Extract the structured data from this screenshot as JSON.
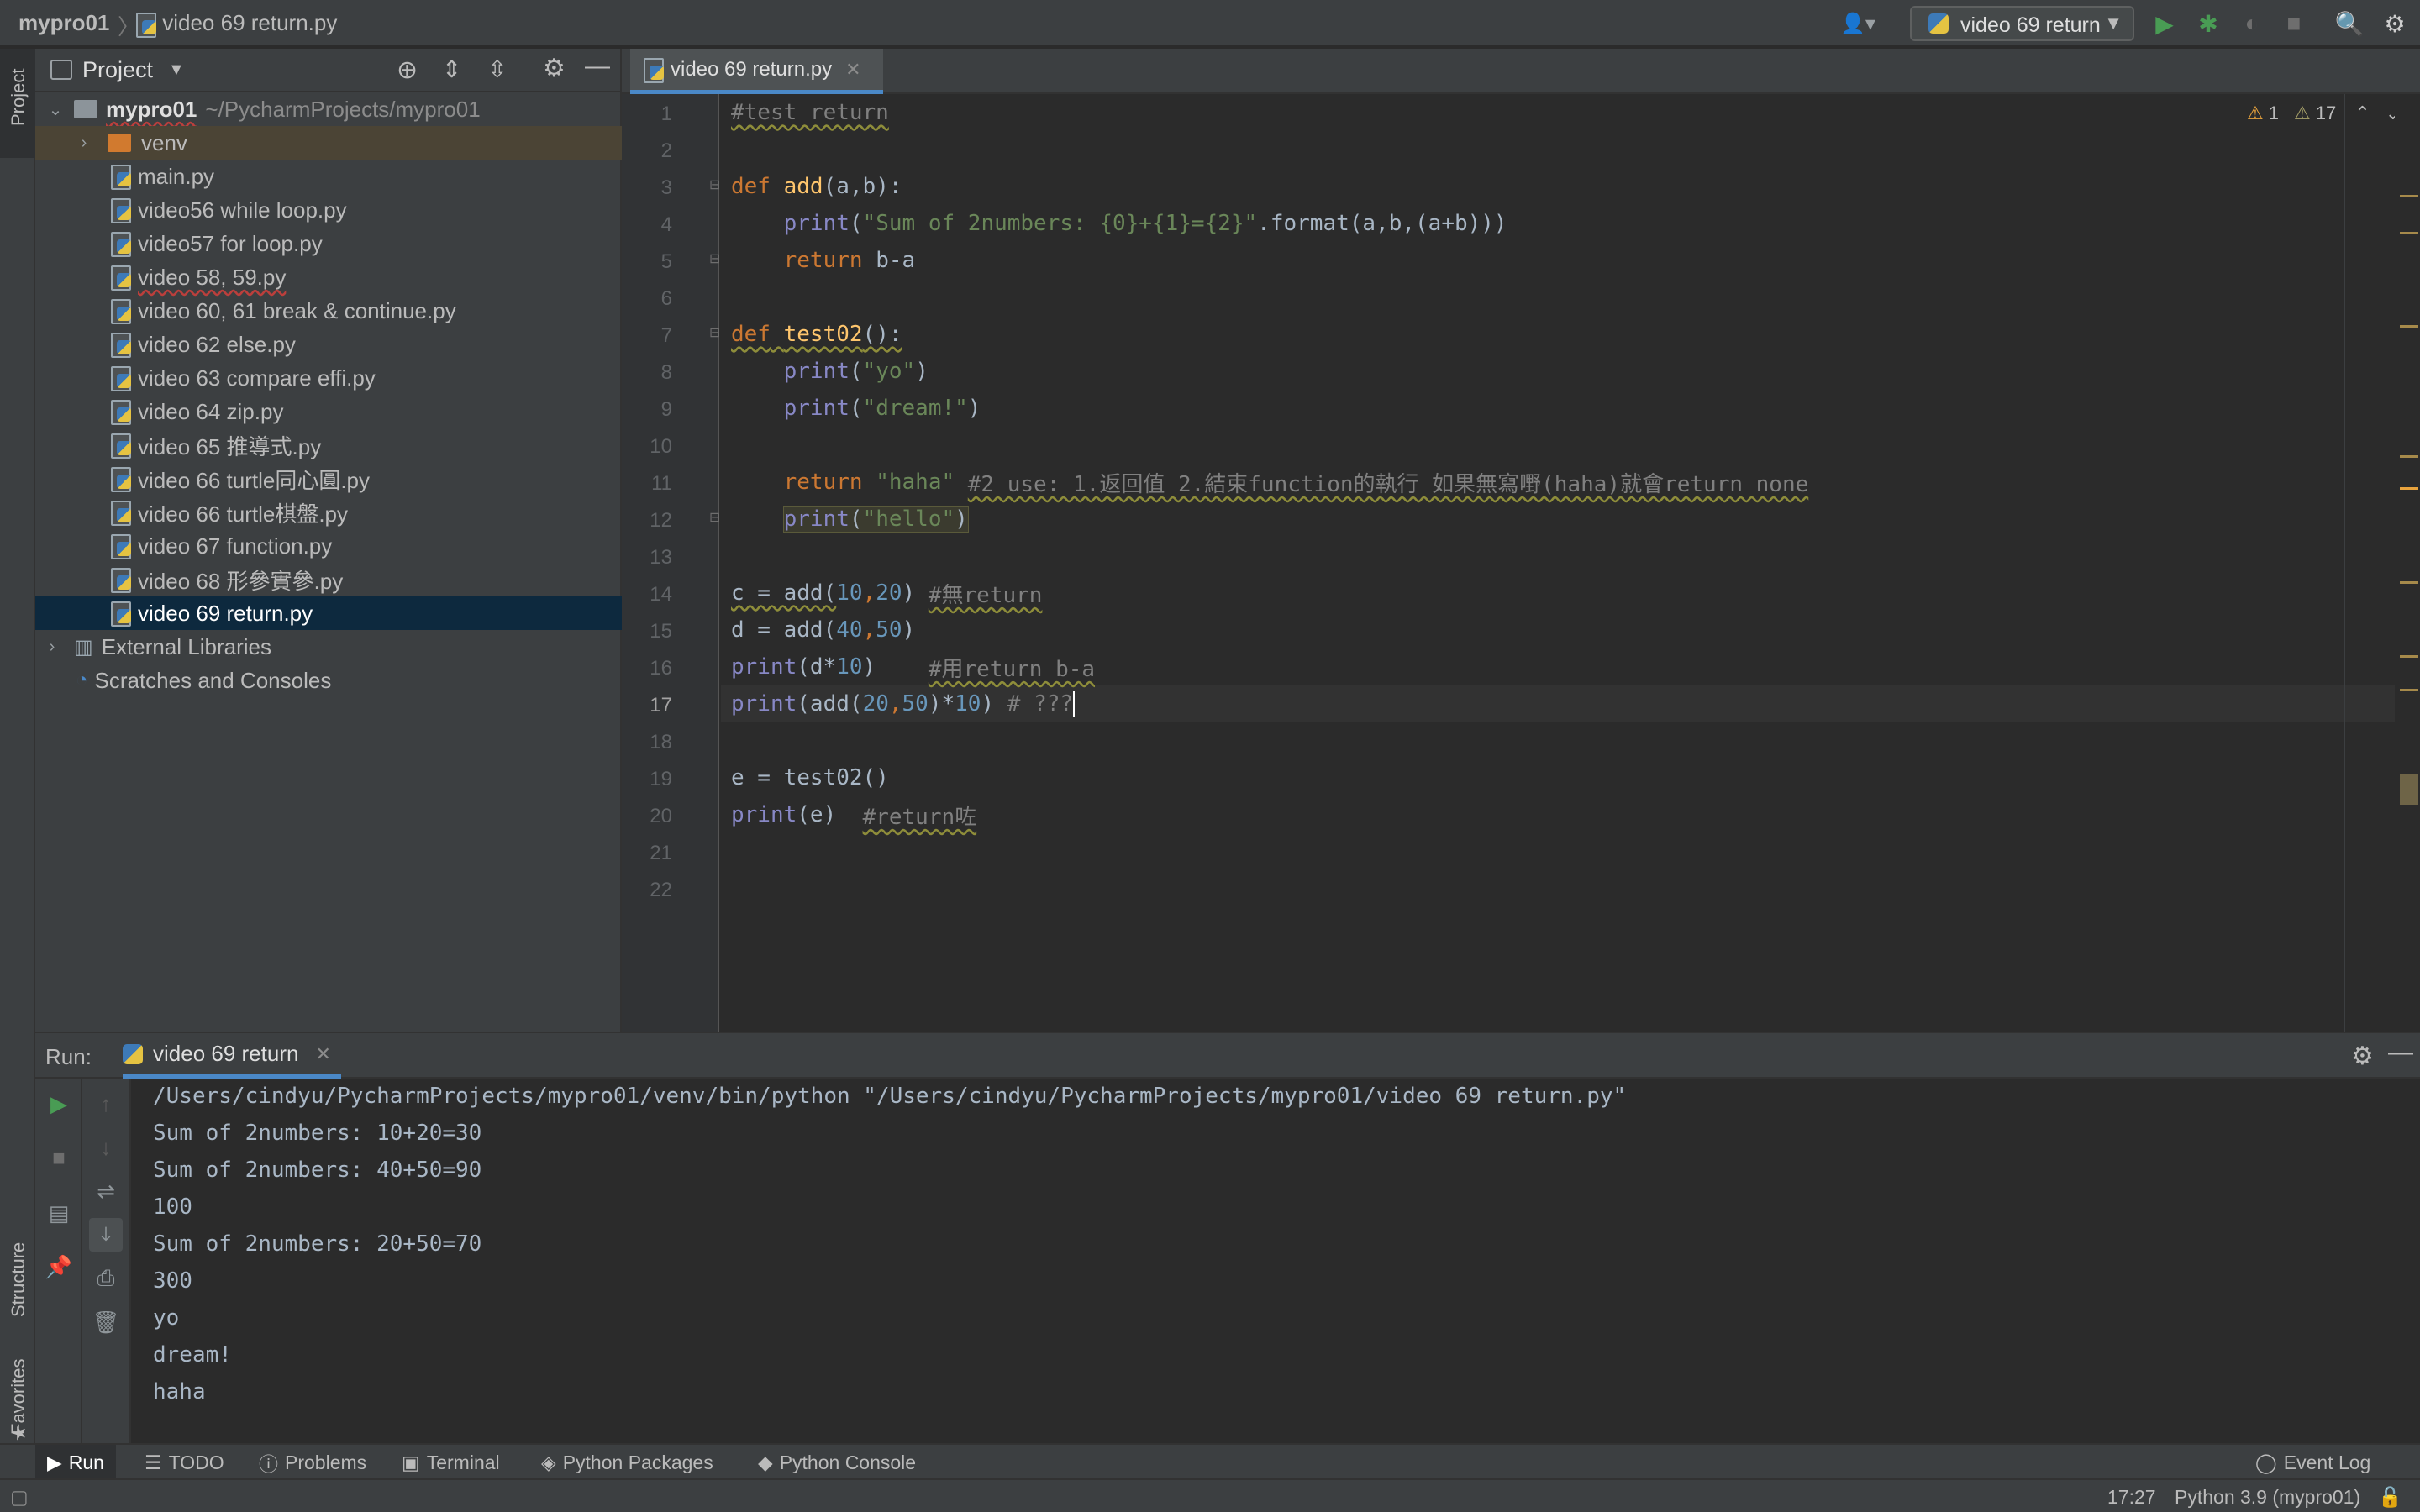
{
  "topbar": {
    "project_name": "mypro01",
    "current_file": "video 69 return.py",
    "run_config_label": "video 69 return",
    "icons": [
      "user-icon",
      "run-icon",
      "debug-icon",
      "coverage-icon",
      "stop-icon",
      "search-icon",
      "settings-icon"
    ]
  },
  "left_stripe": {
    "project_tab": "Project",
    "structure_tab": "Structure",
    "favorites_tab": "Favorites"
  },
  "project_panel": {
    "title": "Project",
    "root_name": "mypro01",
    "root_path": "~/PycharmProjects/mypro01",
    "venv": "venv",
    "files": [
      "main.py",
      "video56 while loop.py",
      "video57 for loop.py",
      "video 58, 59.py",
      "video 60, 61 break & continue.py",
      "video 62 else.py",
      "video 63 compare effi.py",
      "video 64 zip.py",
      "video 65 推導式.py",
      "video 66 turtle同心圓.py",
      "video 66 turtle棋盤.py",
      "video 67 function.py",
      "video 68 形參實參.py",
      "video 69 return.py"
    ],
    "external_libraries": "External Libraries",
    "scratches": "Scratches and Consoles"
  },
  "editor": {
    "tab_label": "video 69 return.py",
    "warnings_count": "1",
    "weak_warnings_count": "17",
    "current_line": 17,
    "line_numbers": [
      "1",
      "2",
      "3",
      "4",
      "5",
      "6",
      "7",
      "8",
      "9",
      "10",
      "11",
      "12",
      "13",
      "14",
      "15",
      "16",
      "17",
      "18",
      "19",
      "20",
      "21",
      "22"
    ],
    "code": {
      "l1": "#test return",
      "l3_kw": "def",
      "l3_fn": "add",
      "l3_rest": "(a,b):",
      "l4_print": "print",
      "l4_str": "\"Sum of 2numbers: {0}+{1}={2}\"",
      "l4_rest": ".format(a,b,(a+b)))",
      "l5_kw": "return",
      "l5_rest": " b-a",
      "l7_kw": "def",
      "l7_fn": "test02",
      "l7_rest": "():",
      "l8_print": "print",
      "l8_str": "\"yo\"",
      "l9_print": "print",
      "l9_str": "\"dream!\"",
      "l11_kw": "return",
      "l11_str": "\"haha\"",
      "l11_cm": "#2 use: 1.返回值 2.結束function的執行 如果無寫嘢(haha)就會return none",
      "l12_print": "print",
      "l12_str": "\"hello\"",
      "l14_a": "c = add(",
      "l14_n1": "10",
      "l14_n2": "20",
      "l14_cm": "#無return",
      "l15_a": "d = add(",
      "l15_n1": "40",
      "l15_n2": "50",
      "l16_print": "print",
      "l16_a": "(d*",
      "l16_n": "10",
      "l16_cm": "#用return b-a",
      "l17_print": "print",
      "l17_a": "(add(",
      "l17_n1": "20",
      "l17_n2": "50",
      "l17_n3": "10",
      "l17_cm": "# ???",
      "l19": "e = test02()",
      "l20_print": "print",
      "l20_a": "(e)",
      "l20_cm": "#return咗"
    }
  },
  "run_panel": {
    "label": "Run:",
    "tab": "video 69 return",
    "output": [
      "/Users/cindyu/PycharmProjects/mypro01/venv/bin/python \"/Users/cindyu/PycharmProjects/mypro01/video 69 return.py\"",
      "Sum of 2numbers: 10+20=30",
      "Sum of 2numbers: 40+50=90",
      "100",
      "Sum of 2numbers: 20+50=70",
      "300",
      "yo",
      "dream!",
      "haha"
    ]
  },
  "bottom_tabs": {
    "run": "Run",
    "todo": "TODO",
    "problems": "Problems",
    "terminal": "Terminal",
    "python_packages": "Python Packages",
    "python_console": "Python Console",
    "event_log": "Event Log"
  },
  "status_bar": {
    "position": "17:27",
    "interpreter": "Python 3.9 (mypro01)"
  },
  "colors": {
    "background": "#2b2b2b",
    "panel": "#3c3f41",
    "selection": "#0d293e",
    "keyword": "#cc7832",
    "function": "#ffc66d",
    "string": "#6a8759",
    "number": "#6897bb",
    "comment": "#808080",
    "run_green": "#499c54"
  }
}
